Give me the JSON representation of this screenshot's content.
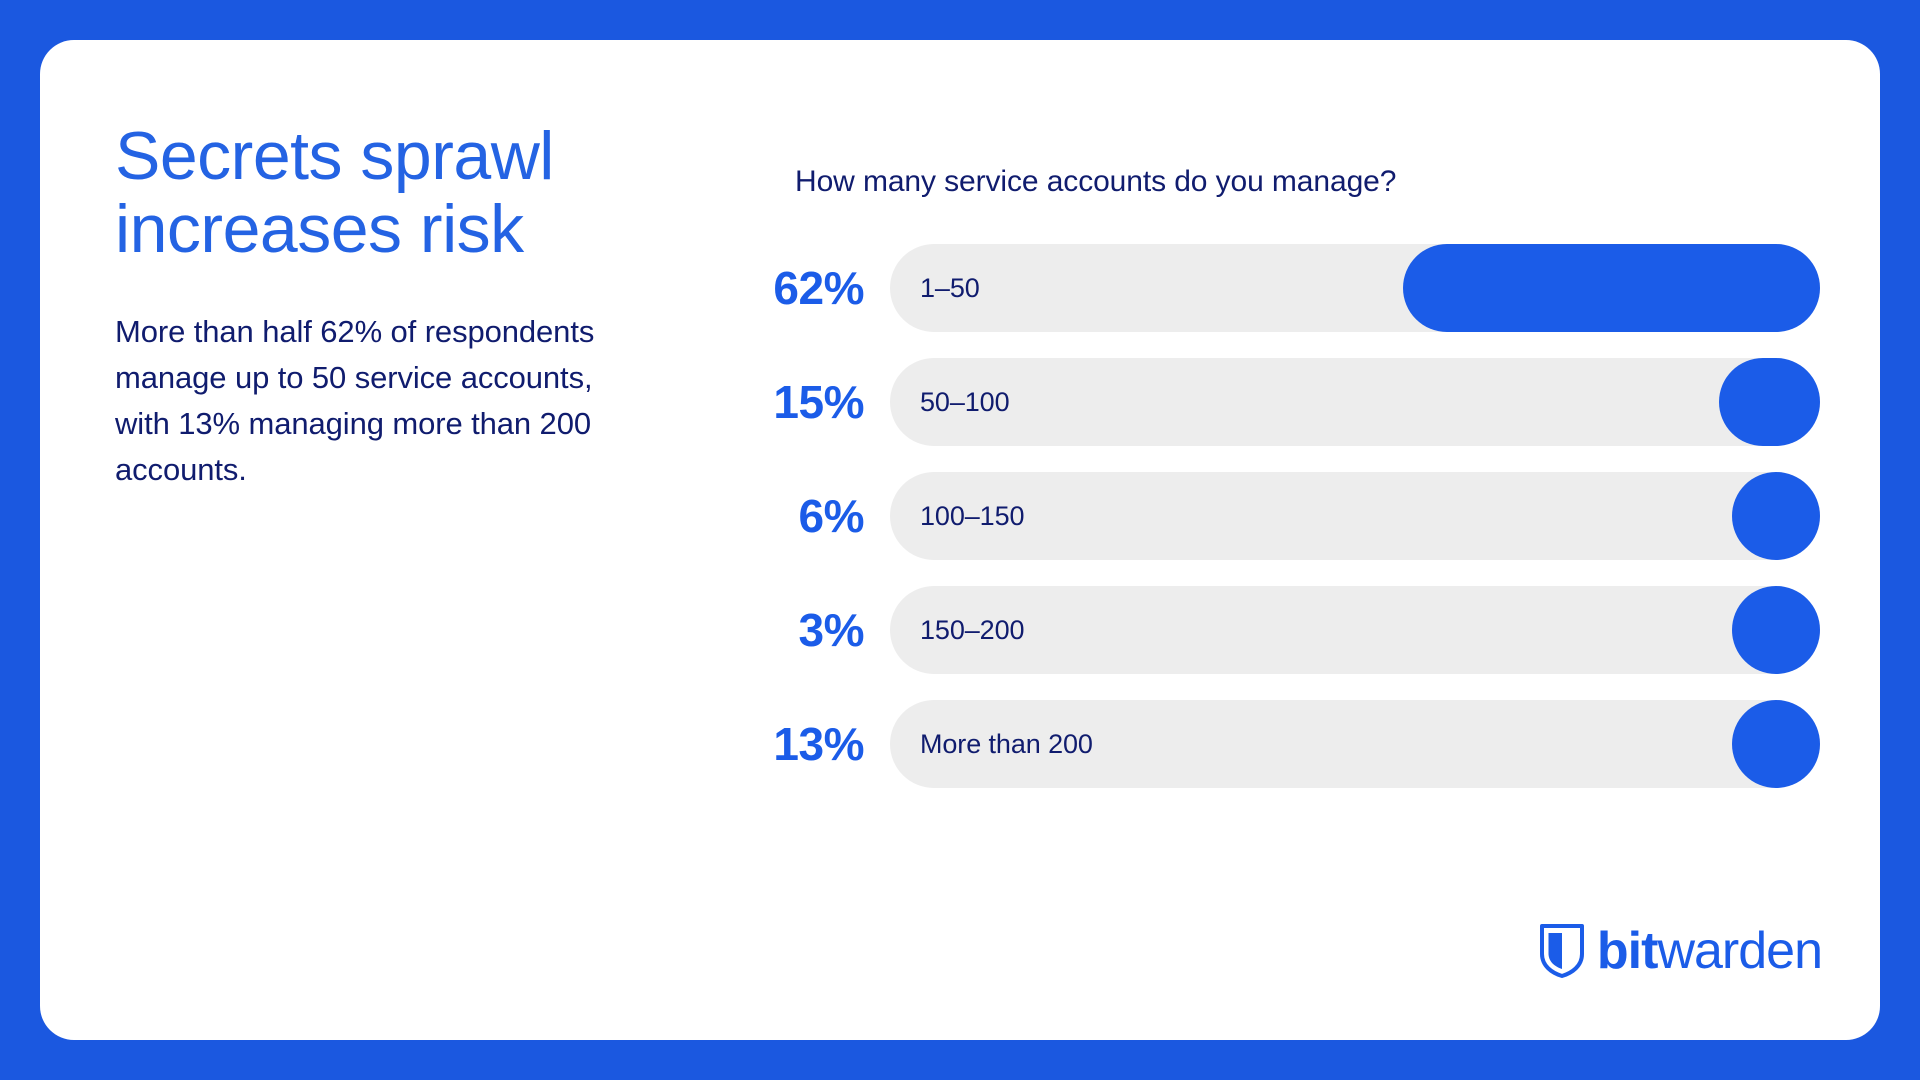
{
  "theme": {
    "page_background": "#1B58E0",
    "card_background": "#FFFFFF",
    "accent_blue": "#1B5CE8",
    "headline_blue": "#2463E3",
    "navy_text": "#101C6E",
    "track_gray": "#EDEDED"
  },
  "left": {
    "headline": "Secrets sprawl increases risk",
    "body": "More than half 62% of respondents manage up to 50 service accounts, with 13% managing more than 200 accounts."
  },
  "chart_data": {
    "type": "bar",
    "title": "How many service accounts do you manage?",
    "xlabel": "",
    "ylabel": "",
    "orientation": "horizontal",
    "grid": false,
    "legend": false,
    "xlim": [
      0,
      100
    ],
    "value_suffix": "%",
    "categories": [
      "1–50",
      "50–100",
      "100–150",
      "150–200",
      "More than 200"
    ],
    "values": [
      62,
      15,
      6,
      3,
      13
    ],
    "value_labels": [
      "62%",
      "15%",
      "6%",
      "3%",
      "13%"
    ],
    "bars": [
      {
        "label": "1–50",
        "value": 62,
        "value_label": "62%"
      },
      {
        "label": "50–100",
        "value": 15,
        "value_label": "15%"
      },
      {
        "label": "100–150",
        "value": 6,
        "value_label": "6%"
      },
      {
        "label": "150–200",
        "value": 3,
        "value_label": "3%"
      },
      {
        "label": "More than 200",
        "value": 13,
        "value_label": "13%"
      }
    ]
  },
  "logo": {
    "mark": "bitwarden-shield-icon",
    "name_bold": "bit",
    "name_light": "warden"
  }
}
